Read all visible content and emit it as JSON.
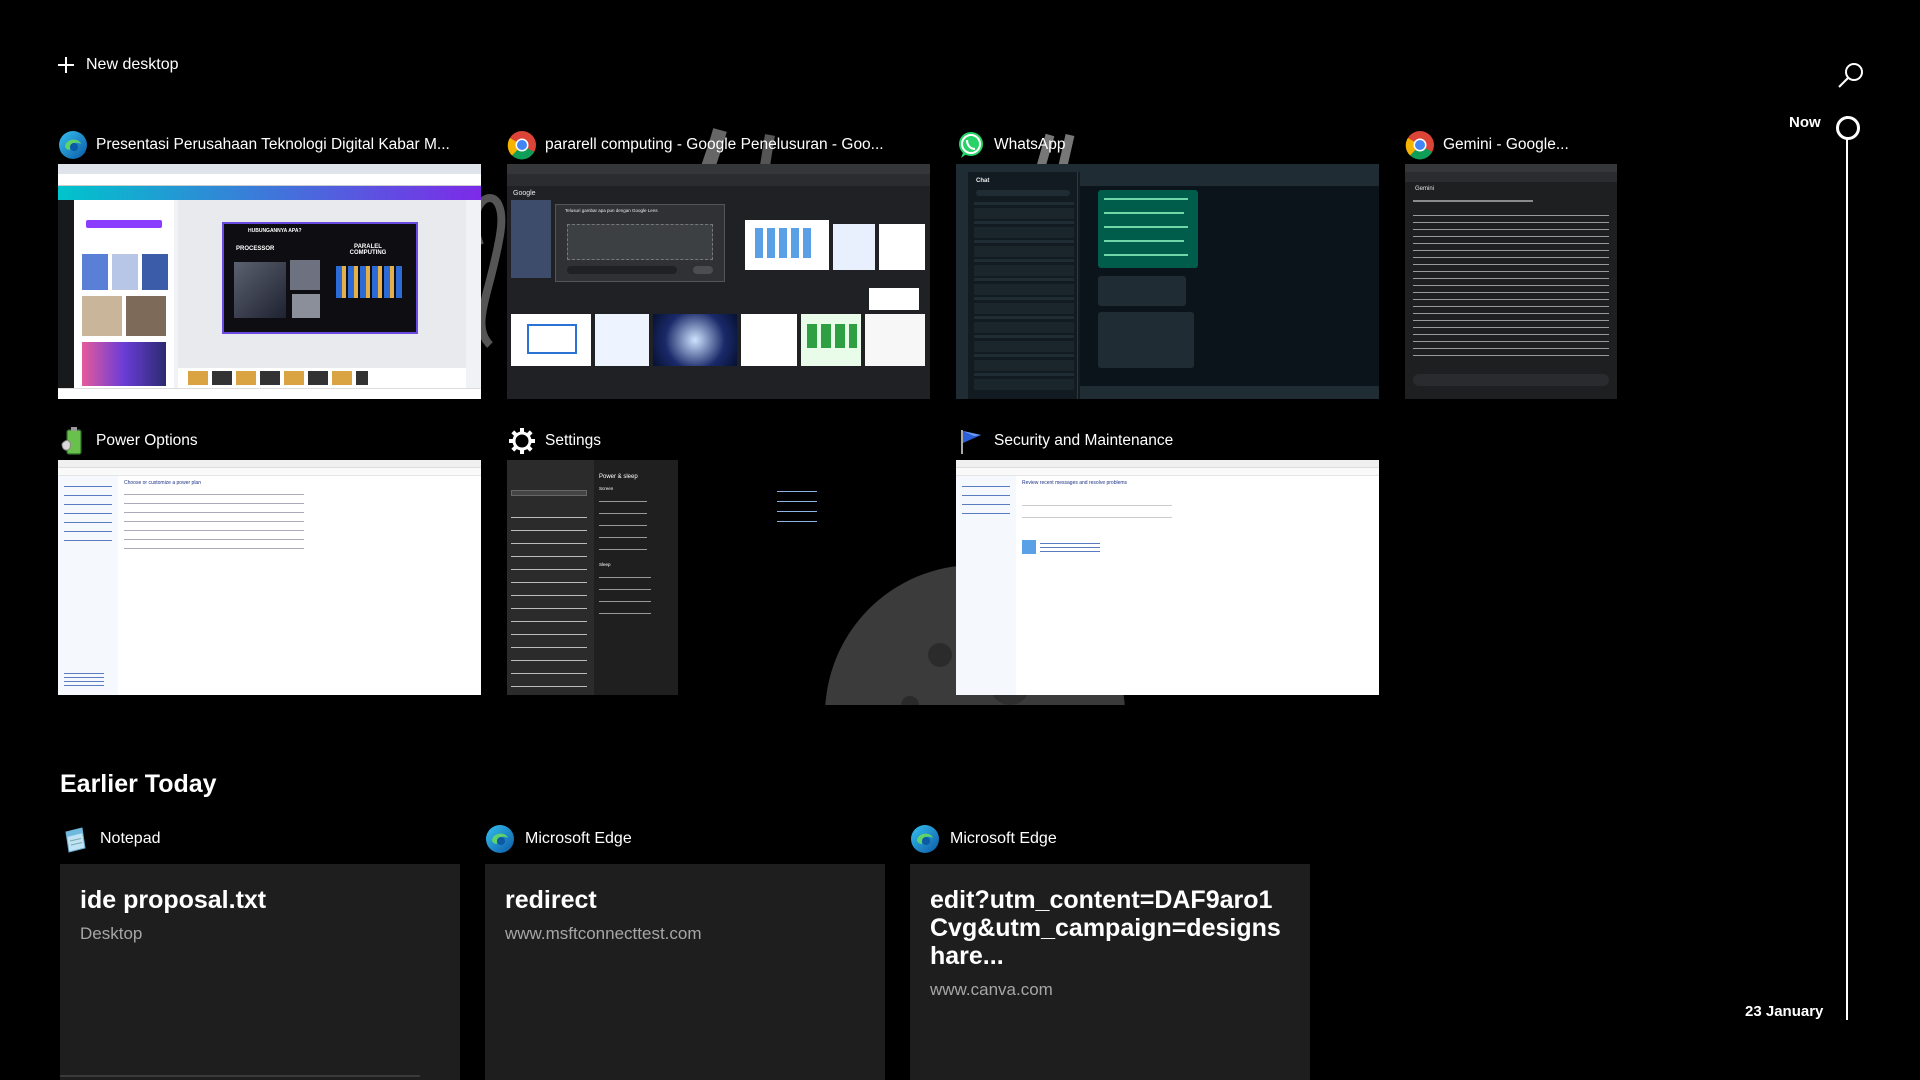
{
  "toolbar": {
    "new_desktop_label": "New desktop"
  },
  "timeline": {
    "now_label": "Now",
    "date_label": "23 January"
  },
  "windows": [
    {
      "app": "edge",
      "title": "Presentasi Perusahaan Teknologi Digital Kabar M...",
      "thumb_heading": "HUBUNGANNYA APA?",
      "thumb_left": "PROCESSOR",
      "thumb_right": "PARALEL COMPUTING"
    },
    {
      "app": "chrome",
      "title": "pararell computing - Google Penelusuran - Goo...",
      "thumb_heading": "Google",
      "thumb_dialog": "Telusuri gambar apa pun dengan Google Lens"
    },
    {
      "app": "whatsapp",
      "title": "WhatsApp",
      "thumb_heading": "Chat"
    },
    {
      "app": "chrome",
      "title": "Gemini - Google...",
      "thumb_heading": "Gemini"
    },
    {
      "app": "power",
      "title": "Power Options",
      "thumb_heading": "Choose or customize a power plan"
    },
    {
      "app": "settings",
      "title": "Settings",
      "thumb_heading": "Power & sleep",
      "thumb_screen": "Screen",
      "thumb_sleep": "Sleep"
    },
    {
      "app": "security",
      "title": "Security and Maintenance",
      "thumb_heading": "Review recent messages and resolve problems"
    }
  ],
  "earlier": {
    "heading": "Earlier Today",
    "activities": [
      {
        "app": "notepad",
        "name": "Notepad",
        "main": "ide proposal.txt",
        "sub": "Desktop"
      },
      {
        "app": "edge",
        "name": "Microsoft Edge",
        "main": "redirect",
        "sub": "www.msftconnecttest.com"
      },
      {
        "app": "edge",
        "name": "Microsoft Edge",
        "main": "edit?utm_content=DAF9aro1Cvg&utm_campaign=designshare...",
        "sub": "www.canva.com"
      }
    ]
  }
}
